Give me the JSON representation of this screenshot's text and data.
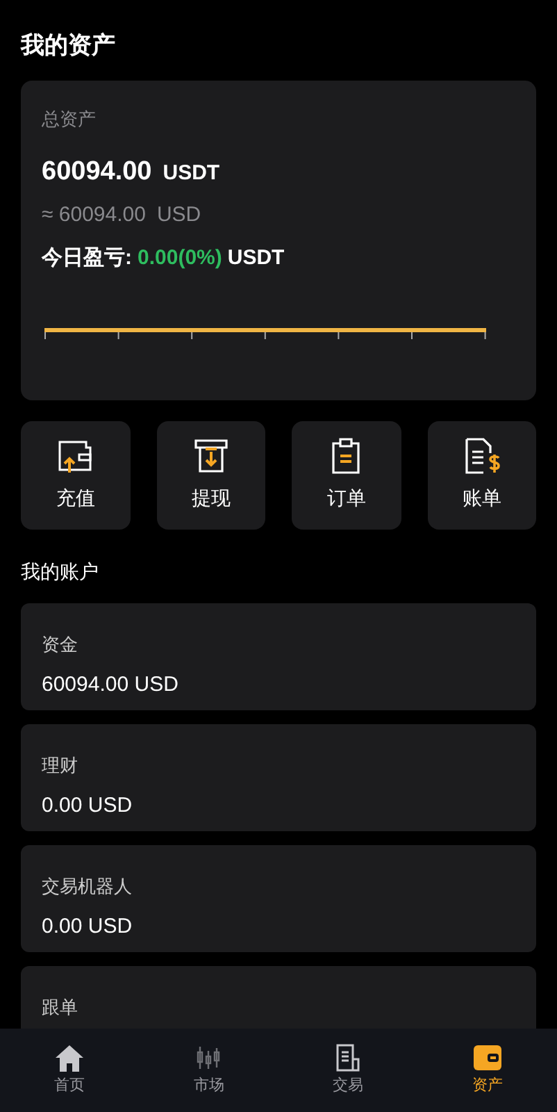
{
  "page_title": "我的资产",
  "summary": {
    "label": "总资产",
    "amount": "60094.00",
    "unit": "USDT",
    "approx": "≈ 60094.00",
    "approx_unit": "USD",
    "pnl_label": "今日盈亏:",
    "pnl_value": "0.00(0%)",
    "pnl_unit": "USDT"
  },
  "actions": [
    {
      "kind": "deposit",
      "label": "充值"
    },
    {
      "kind": "withdraw",
      "label": "提现"
    },
    {
      "kind": "orders",
      "label": "订单"
    },
    {
      "kind": "bills",
      "label": "账单"
    }
  ],
  "accounts_title": "我的账户",
  "accounts": [
    {
      "name": "资金",
      "value": "60094.00 USD"
    },
    {
      "name": "理财",
      "value": "0.00 USD"
    },
    {
      "name": "交易机器人",
      "value": "0.00 USD"
    },
    {
      "name": "跟单"
    }
  ],
  "tabbar": [
    {
      "kind": "home",
      "label": "首页",
      "selected": false
    },
    {
      "kind": "market",
      "label": "市场",
      "selected": false
    },
    {
      "kind": "trade",
      "label": "交易",
      "selected": false
    },
    {
      "kind": "assets",
      "label": "资产",
      "selected": true
    }
  ]
}
